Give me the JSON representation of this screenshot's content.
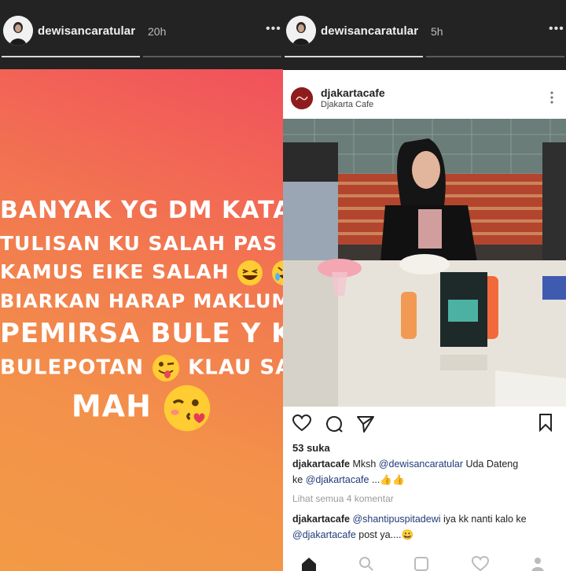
{
  "left_story": {
    "username": "dewisancaratular",
    "time": "20h",
    "more_label": "•••",
    "lines": [
      "BANYAK YG DM KATA Y",
      "TULISAN KU SALAH PAS LIHAT",
      "KAMUS EIKE SALAH",
      "BIARKAN HARAP MAKLUM YAK",
      "PEMIRSA BULE Y KAN",
      "BULEPOTAN",
      "KLAU SAYA",
      "MAH"
    ],
    "colors": {
      "gradient_top": "#f1515c",
      "gradient_bottom": "#f29a46"
    }
  },
  "right_story": {
    "username": "dewisancaratular",
    "time": "5h",
    "more_label": "•••",
    "post": {
      "account": "djakartacafe",
      "location": "Djakarta Cafe",
      "likes": "53 suka",
      "caption_user": "djakartacafe",
      "caption_text_1": "Mksh ",
      "caption_mention_1": "@dewisancaratular",
      "caption_text_2": " Uda Dateng",
      "caption_line2_pre": "ke ",
      "caption_mention_2": "@djakartacafe",
      "caption_text_3": " ...👍👍",
      "view_all": "Lihat semua 4 komentar",
      "comment_user": "djakartacafe",
      "comment_mention_1": "@shantipuspitadewi",
      "comment_text_1": " iya kk nanti kalo ke",
      "comment_mention_2": "@djakartacafe",
      "comment_text_2": " post ya....😀"
    }
  }
}
